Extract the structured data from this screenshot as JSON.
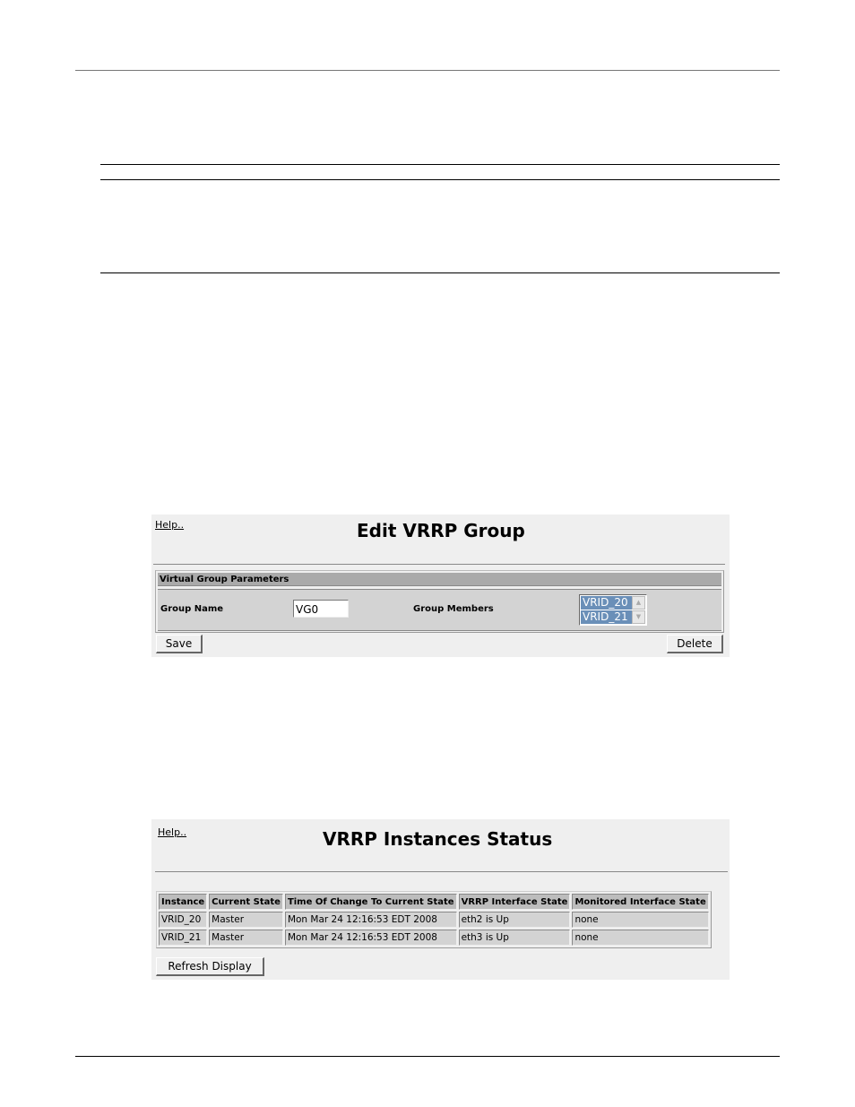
{
  "edit_group": {
    "help_link": "Help..",
    "title": "Edit VRRP Group",
    "section_header": "Virtual Group Parameters",
    "group_name_label": "Group Name",
    "group_name_value": "VG0",
    "group_members_label": "Group Members",
    "group_members": [
      "VRID_20",
      "VRID_21"
    ],
    "save_label": "Save",
    "delete_label": "Delete"
  },
  "status_panel": {
    "help_link": "Help..",
    "title": "VRRP Instances Status",
    "columns": [
      "Instance",
      "Current State",
      "Time Of Change To Current State",
      "VRRP Interface State",
      "Monitored Interface State"
    ],
    "rows": [
      [
        "VRID_20",
        "Master",
        "Mon Mar 24 12:16:53 EDT 2008",
        "eth2 is Up",
        "none"
      ],
      [
        "VRID_21",
        "Master",
        "Mon Mar 24 12:16:53 EDT 2008",
        "eth3 is Up",
        "none"
      ]
    ],
    "refresh_label": "Refresh Display"
  },
  "icons": {
    "scroll_up": "▲",
    "scroll_down": "▼"
  }
}
